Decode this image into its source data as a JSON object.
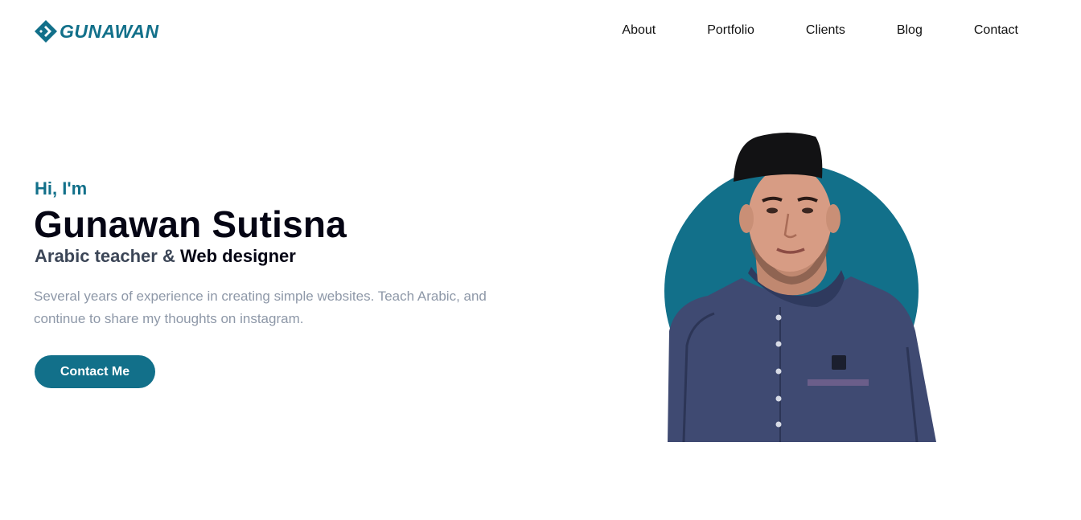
{
  "brand": {
    "name": "GUNAWAN",
    "logo_icon": "diamond-logo-icon",
    "color": "#12708a"
  },
  "nav": [
    {
      "label": "About"
    },
    {
      "label": "Portfolio"
    },
    {
      "label": "Clients"
    },
    {
      "label": "Blog"
    },
    {
      "label": "Contact"
    }
  ],
  "hero": {
    "greeting": "Hi, I'm",
    "name": "Gunawan Sutisna",
    "role_primary": "Arabic teacher",
    "role_joiner": "&",
    "role_secondary": "Web designer",
    "description": "Several years of experience in creating simple websites. Teach Arabic, and continue to share my thoughts on instagram.",
    "cta_label": "Contact Me"
  },
  "colors": {
    "accent": "#12708a",
    "muted_text": "#8e98a8",
    "dark_text": "#050514"
  }
}
